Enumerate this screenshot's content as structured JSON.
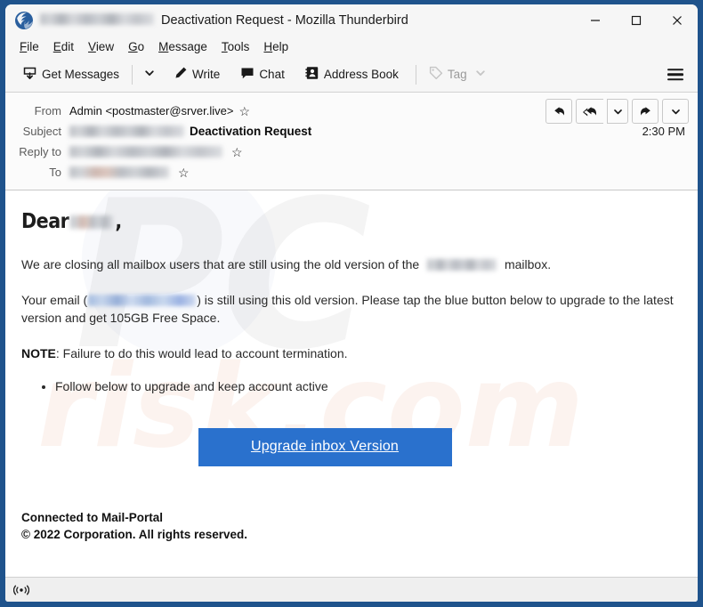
{
  "window": {
    "title_redacted": "[redacted-email]",
    "title": "Deactivation Request - Mozilla Thunderbird",
    "app_icon": "thunderbird-icon",
    "minimize_label": "–",
    "maximize_label": "□",
    "close_label": "✕",
    "frame_color": "#1f538c"
  },
  "menubar": {
    "items": [
      {
        "label": "File",
        "accesskey": "F"
      },
      {
        "label": "Edit",
        "accesskey": "E"
      },
      {
        "label": "View",
        "accesskey": "V"
      },
      {
        "label": "Go",
        "accesskey": "G"
      },
      {
        "label": "Message",
        "accesskey": "M"
      },
      {
        "label": "Tools",
        "accesskey": "T"
      },
      {
        "label": "Help",
        "accesskey": "H"
      }
    ]
  },
  "toolbar": {
    "get_messages": "Get Messages",
    "get_messages_icon": "download-inbox-icon",
    "get_messages_caret": "chevron-down-icon",
    "write": "Write",
    "write_icon": "pencil-icon",
    "chat": "Chat",
    "chat_icon": "speech-bubble-icon",
    "address_book": "Address Book",
    "address_book_icon": "address-book-icon",
    "tag": "Tag",
    "tag_icon": "tag-icon",
    "tag_caret": "chevron-down-icon",
    "tag_disabled": true,
    "app_menu_icon": "hamburger-menu-icon"
  },
  "message_header": {
    "from_label": "From",
    "from_value": "Admin <postmaster@srver.live>",
    "subject_label": "Subject",
    "subject_redacted": "[redacted-email]",
    "subject_value": "Deactivation Request",
    "reply_to_label": "Reply to",
    "reply_to_redacted": "[redacted-email]",
    "to_label": "To",
    "to_redacted": "[redacted-email]",
    "time": "2:30 PM",
    "star_icon": "star-outline-icon",
    "actions": [
      {
        "name": "reply-button",
        "icon": "reply-arrow-icon"
      },
      {
        "name": "reply-all-button",
        "icon": "reply-all-arrow-icon"
      },
      {
        "name": "reply-all-dropdown",
        "icon": "chevron-down-icon"
      },
      {
        "name": "forward-button",
        "icon": "forward-arrow-icon"
      },
      {
        "name": "more-actions-dropdown",
        "icon": "chevron-down-icon"
      }
    ]
  },
  "body": {
    "greeting_prefix": "Dear",
    "greeting_redacted": "[redacted-name]",
    "greeting_suffix": ",",
    "para1_before": "We are closing all mailbox users that are still using the old version of  the",
    "para1_redacted": "[redacted-domain]",
    "para1_after": "mailbox.",
    "para2_before": "Your email   (",
    "para2_redacted": "[redacted-email]",
    "para2_after": ")  is still using this old version. Please tap the blue button below to upgrade to the latest version and get 105GB Free Space.",
    "note_label": "NOTE",
    "note_text": ":  Failure to do this would lead to account termination.",
    "bullets": [
      "Follow  below to upgrade and keep account active"
    ],
    "cta_label": "Upgrade inbox Version",
    "cta_color": "#2a71cd",
    "footer_line1": "Connected to Mail-Portal",
    "footer_line2": "© 2022  Corporation. All rights reserved."
  },
  "watermark": {
    "text_top": "PC",
    "text_bottom": "risk.com"
  },
  "statusbar": {
    "icon": "network-activity-icon"
  }
}
